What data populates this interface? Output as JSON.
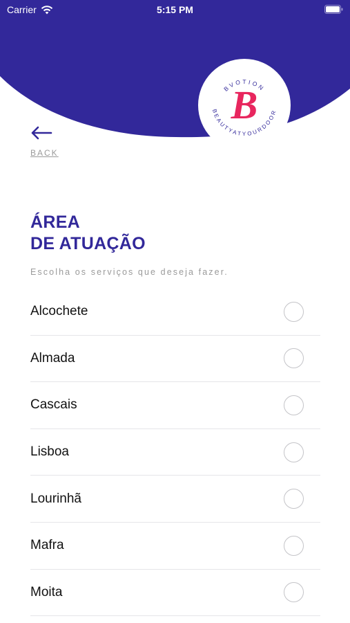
{
  "status_bar": {
    "carrier": "Carrier",
    "time": "5:15 PM"
  },
  "logo": {
    "brand": "BVOTION",
    "tagline": "BEAUTYATYOURDOOR",
    "monogram": "B"
  },
  "back": {
    "label": "BACK"
  },
  "title": {
    "line1": "ÁREA",
    "line2": "DE ATUAÇÃO"
  },
  "subtitle": "Escolha os serviços que deseja fazer.",
  "options": [
    {
      "label": "Alcochete",
      "selected": false
    },
    {
      "label": "Almada",
      "selected": false
    },
    {
      "label": "Cascais",
      "selected": false
    },
    {
      "label": "Lisboa",
      "selected": false
    },
    {
      "label": "Lourinhã",
      "selected": false
    },
    {
      "label": "Mafra",
      "selected": false
    },
    {
      "label": "Moita",
      "selected": false
    }
  ],
  "colors": {
    "brand_purple": "#32289a",
    "logo_pink": "#e8265e",
    "muted_text": "#9a9a9a"
  },
  "icons": [
    "wifi-icon",
    "battery-icon",
    "back-arrow-icon",
    "radio-unchecked-icon"
  ]
}
